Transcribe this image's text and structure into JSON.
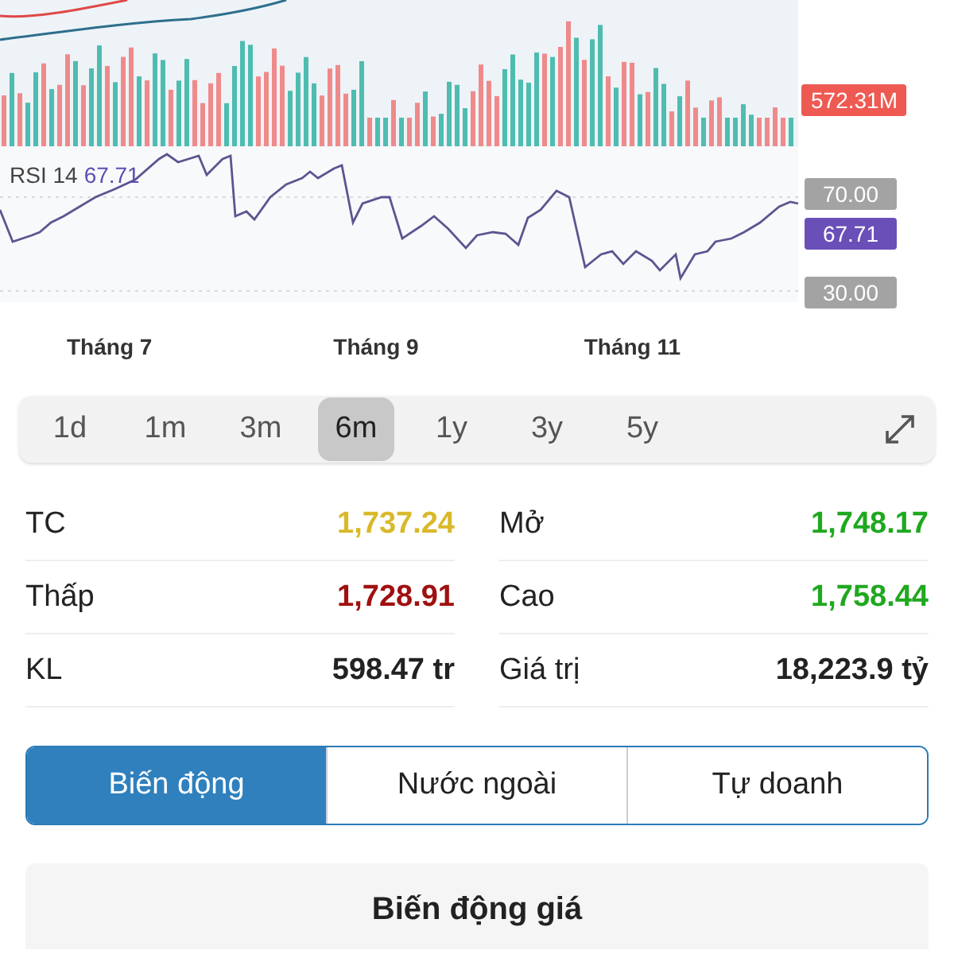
{
  "chart": {
    "volume_label": "572.31M",
    "rsi": {
      "title": "RSI 14",
      "value": "67.71"
    },
    "rsi_axis": [
      {
        "text": "70.00",
        "kind": "level"
      },
      {
        "text": "67.71",
        "kind": "current"
      },
      {
        "text": "30.00",
        "kind": "level"
      }
    ],
    "months": [
      "Tháng 7",
      "Tháng 9",
      "Tháng 11"
    ]
  },
  "ranges": [
    {
      "label": "1d",
      "selected": false
    },
    {
      "label": "1m",
      "selected": false
    },
    {
      "label": "3m",
      "selected": false
    },
    {
      "label": "6m",
      "selected": true
    },
    {
      "label": "1y",
      "selected": false
    },
    {
      "label": "3y",
      "selected": false
    },
    {
      "label": "5y",
      "selected": false
    }
  ],
  "stats": [
    {
      "label": "TC",
      "value": "1,737.24",
      "color": "#d9b92a"
    },
    {
      "label": "Mở",
      "value": "1,748.17",
      "color": "#1fa81f"
    },
    {
      "label": "Thấp",
      "value": "1,728.91",
      "color": "#a01010"
    },
    {
      "label": "Cao",
      "value": "1,758.44",
      "color": "#1fa81f"
    },
    {
      "label": "KL",
      "value": "598.47 tr",
      "color": "#222222"
    },
    {
      "label": "Giá trị",
      "value": "18,223.9 tỷ",
      "color": "#222222"
    }
  ],
  "tabs": [
    {
      "label": "Biến động",
      "selected": true
    },
    {
      "label": "Nước ngoài",
      "selected": false
    },
    {
      "label": "Tự doanh",
      "selected": false
    }
  ],
  "section": {
    "title": "Biến động giá"
  }
}
